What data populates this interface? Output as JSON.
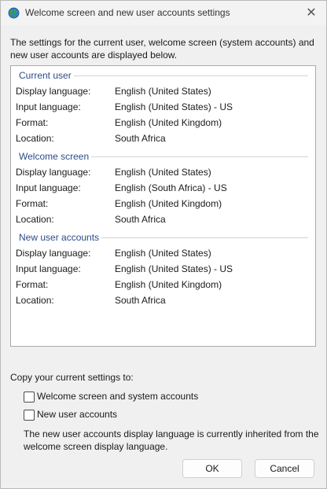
{
  "window": {
    "title": "Welcome screen and new user accounts settings",
    "close_glyph": "✕"
  },
  "intro": "The settings for the current user, welcome screen (system accounts) and new user accounts are displayed below.",
  "groups": [
    {
      "title": "Current user",
      "rows": [
        {
          "label": "Display language:",
          "value": "English (United States)"
        },
        {
          "label": "Input language:",
          "value": "English (United States) - US"
        },
        {
          "label": "Format:",
          "value": "English (United Kingdom)"
        },
        {
          "label": "Location:",
          "value": "South Africa"
        }
      ]
    },
    {
      "title": "Welcome screen",
      "rows": [
        {
          "label": "Display language:",
          "value": "English (United States)"
        },
        {
          "label": "Input language:",
          "value": "English (South Africa) - US"
        },
        {
          "label": "Format:",
          "value": "English (United Kingdom)"
        },
        {
          "label": "Location:",
          "value": "South Africa"
        }
      ]
    },
    {
      "title": "New user accounts",
      "rows": [
        {
          "label": "Display language:",
          "value": "English (United States)"
        },
        {
          "label": "Input language:",
          "value": "English (United States) - US"
        },
        {
          "label": "Format:",
          "value": "English (United Kingdom)"
        },
        {
          "label": "Location:",
          "value": "South Africa"
        }
      ]
    }
  ],
  "copy": {
    "label": "Copy your current settings to:",
    "options": [
      {
        "label": "Welcome screen and system accounts",
        "checked": false
      },
      {
        "label": "New user accounts",
        "checked": false
      }
    ],
    "note": "The new user accounts display language is currently inherited from the welcome screen display language."
  },
  "buttons": {
    "ok": "OK",
    "cancel": "Cancel"
  },
  "colors": {
    "group_title": "#2a4d8a",
    "background": "#f0f0f0",
    "panel": "#ffffff"
  },
  "icons": {
    "app": "globe-icon",
    "close": "close-icon"
  }
}
